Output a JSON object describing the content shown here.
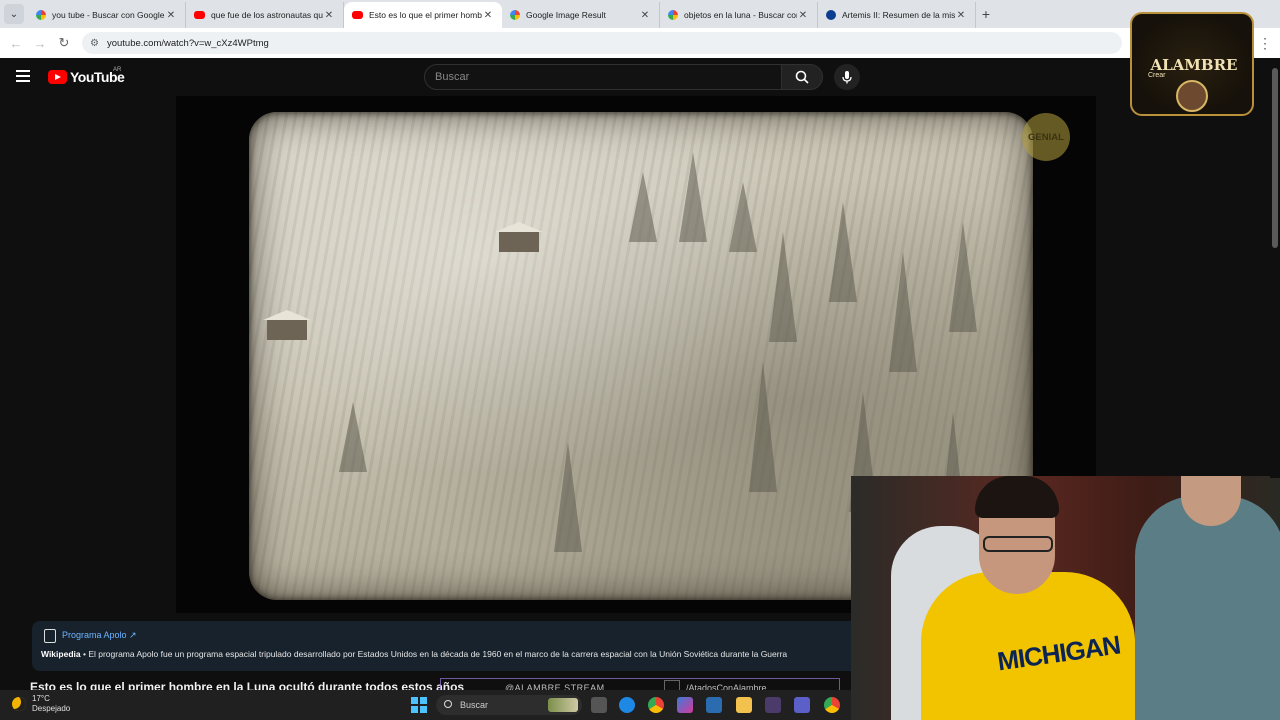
{
  "browser": {
    "tabs": [
      {
        "title": "you tube - Buscar con Google",
        "icon": "google-icon",
        "active": false
      },
      {
        "title": "que fue de los astronautas que",
        "icon": "youtube-icon",
        "active": false
      },
      {
        "title": "Esto es lo que el primer hombre",
        "icon": "youtube-icon",
        "active": true
      },
      {
        "title": "Google Image Result",
        "icon": "google-icon",
        "active": false
      },
      {
        "title": "objetos en la luna - Buscar con",
        "icon": "google-icon",
        "active": false
      },
      {
        "title": "Artemis II: Resumen de la misió",
        "icon": "nasa-icon",
        "active": false
      }
    ],
    "url": "youtube.com/watch?v=w_cXz4WPtmg"
  },
  "youtube": {
    "logo_text": "YouTube",
    "country_code": "AR",
    "search_placeholder": "Buscar"
  },
  "video": {
    "overlay_badge": "GENIAL",
    "title": "Esto es lo que el primer hombre en la Luna ocultó durante todos estos años"
  },
  "info_card": {
    "title": "Programa Apolo",
    "source": "Wikipedia",
    "text": "El programa Apolo fue un programa espacial tripulado desarrollado por Estados Unidos en la década de 1960 en el marco de la carrera espacial con la Unión Soviética durante la Guerra"
  },
  "stream_overlay": {
    "handle_1": "@ALAMBRE.STREAM",
    "handle_2": "/AtadosConAlambre"
  },
  "webcam": {
    "hoodie_text": "MICHIGAN"
  },
  "channel_badge": {
    "name": "ALAMBRE",
    "sub": "Crear"
  },
  "taskbar": {
    "temperature": "17°C",
    "weather": "Despejado",
    "search_placeholder": "Buscar"
  },
  "colors": {
    "youtube_red": "#ff0000",
    "info_link": "#6fb3ff",
    "hoodie_yellow": "#f2c400"
  }
}
